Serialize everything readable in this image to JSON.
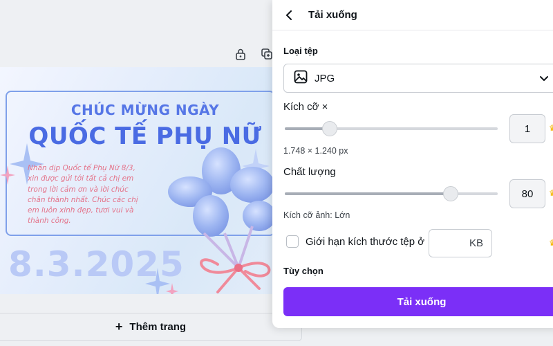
{
  "design": {
    "title_line1": "CHÚC MỪNG NGÀY",
    "title_line2": "QUỐC TẾ PHỤ NỮ",
    "message_lines": [
      "Nhân dịp Quốc tế Phụ Nữ 8/3,",
      "xin được gửi tới tất cả chị em",
      "trong lời cảm ơn và lời chúc",
      "chân thành nhất. Chúc các chị",
      "em luôn xinh đẹp, tươi vui và",
      "thành công."
    ],
    "date": "8.3.2025",
    "add_page_plus": "+",
    "add_page_label": "Thêm trang"
  },
  "toolbar": {
    "lock_icon": "lock-icon",
    "duplicate_icon": "duplicate-icon"
  },
  "panel": {
    "title": "Tải xuống",
    "file_type_label": "Loại tệp",
    "file_type_value": "JPG",
    "size_label": "Kích cỡ ×",
    "size_value": "1",
    "size_slider_fraction": 0.21,
    "dimensions": "1.748 × 1.240 px",
    "quality_label": "Chất lượng",
    "quality_value": "80",
    "quality_slider_fraction": 0.78,
    "image_size_text": "Kích cỡ ảnh: Lớn",
    "limit_label": "Giới hạn kích thước tệp ở",
    "limit_unit": "KB",
    "options_label": "Tùy chọn",
    "download_button": "Tải xuống",
    "premium_icon": "♛"
  },
  "colors": {
    "accent": "#7b2ff7",
    "title_blue": "#4a6be3",
    "message_pink": "#e4738a",
    "crown": "#f5b400"
  }
}
